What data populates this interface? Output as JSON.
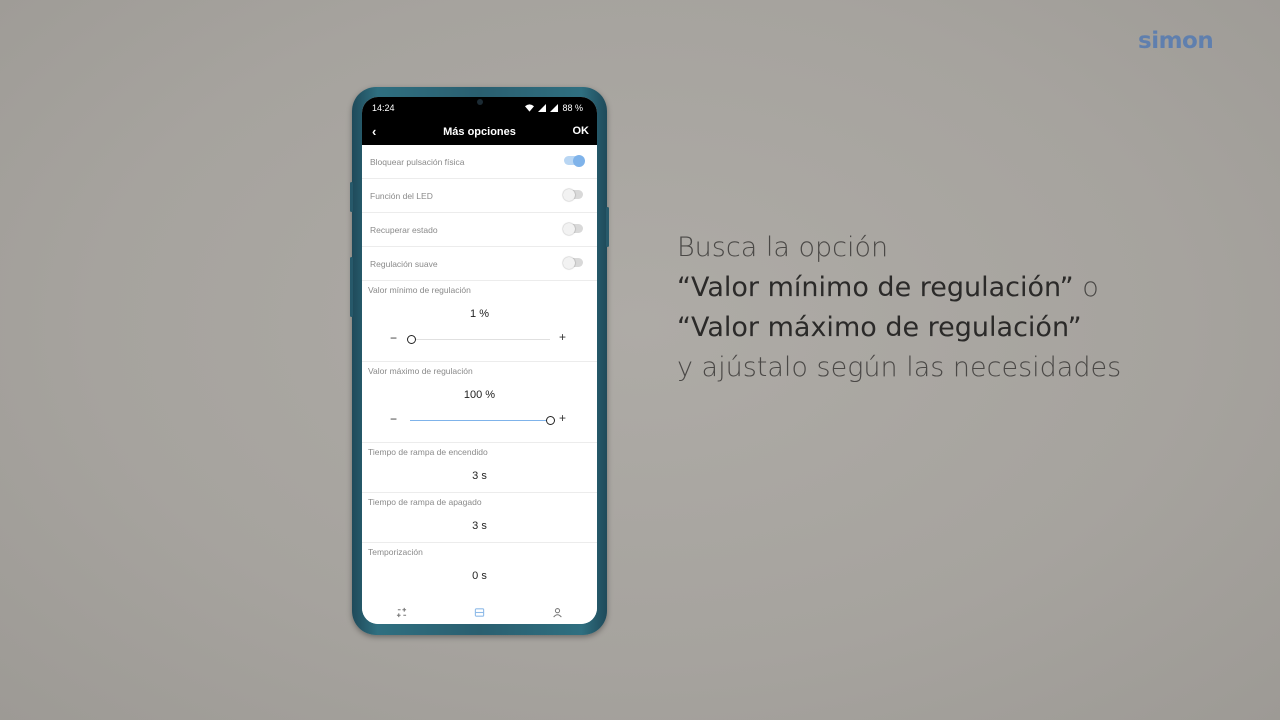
{
  "brand": {
    "logo_text": "simon",
    "color": "#5f7fae"
  },
  "caption": {
    "line1": "Busca la opción",
    "line2": "“Valor mínimo de regulación”",
    "line2_suffix": " o",
    "line3": "“Valor máximo de regulación”",
    "line4": "y ajústalo según las necesidades"
  },
  "status_bar": {
    "time": "14:24",
    "battery": "88 %",
    "icons": [
      "wifi-icon",
      "signal-icon",
      "signal-icon"
    ]
  },
  "app_bar": {
    "back_icon": "chevron-left-icon",
    "title": "Más opciones",
    "ok_label": "OK"
  },
  "settings": [
    {
      "label": "Bloquear pulsación física",
      "enabled": true
    },
    {
      "label": "Función del LED",
      "enabled": false
    },
    {
      "label": "Recuperar estado",
      "enabled": false
    },
    {
      "label": "Regulación suave",
      "enabled": false
    }
  ],
  "min_level": {
    "label": "Valor mínimo de regulación",
    "value": "1 %",
    "level": 0.01,
    "minus": "−",
    "plus": "+"
  },
  "max_level": {
    "label": "Valor máximo de regulación",
    "value": "100 %",
    "level": 1.0,
    "minus": "−",
    "plus": "+"
  },
  "ramp_on": {
    "label": "Tiempo de rampa de encendido",
    "value": "3 s"
  },
  "ramp_off": {
    "label": "Tiempo de rampa de apagado",
    "value": "3 s"
  },
  "timer": {
    "label": "Temporización",
    "value": "0 s"
  },
  "bottom_nav": [
    "devices-icon",
    "rooms-icon",
    "profile-icon"
  ],
  "colors": {
    "accent": "#7fb3ea",
    "phone_body": "#2a5f70"
  }
}
